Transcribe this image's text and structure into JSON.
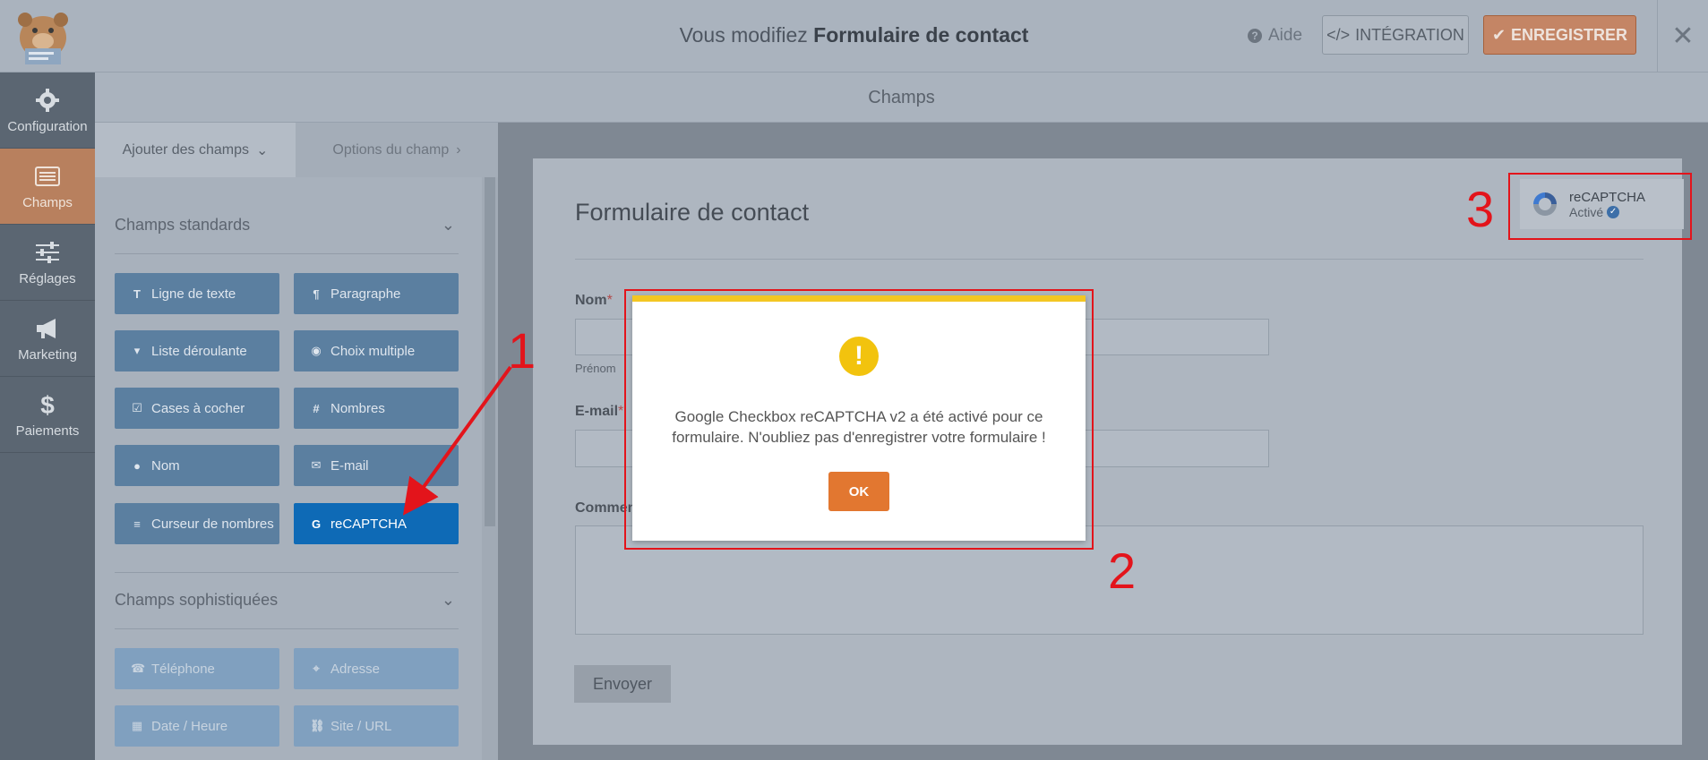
{
  "topbar": {
    "title_prefix": "Vous modifiez",
    "title_form": "Formulaire de contact",
    "help_label": "Aide",
    "embed_label": "INTÉGRATION",
    "save_label": "ENREGISTRER",
    "close_symbol": "✕"
  },
  "nav": {
    "items": [
      {
        "label": "Configuration",
        "icon": "gear-icon"
      },
      {
        "label": "Champs",
        "icon": "fields-icon",
        "active": true
      },
      {
        "label": "Réglages",
        "icon": "sliders-icon"
      },
      {
        "label": "Marketing",
        "icon": "megaphone-icon"
      },
      {
        "label": "Paiements",
        "icon": "dollar-icon"
      }
    ]
  },
  "header": {
    "title": "Champs"
  },
  "panel": {
    "tabs": {
      "add_fields": "Ajouter des champs",
      "field_options": "Options du champ"
    },
    "standard": {
      "title": "Champs standards",
      "buttons": [
        {
          "label": "Ligne de texte",
          "icon": "T"
        },
        {
          "label": "Paragraphe",
          "icon": "¶"
        },
        {
          "label": "Liste déroulante",
          "icon": "▾"
        },
        {
          "label": "Choix multiple",
          "icon": "◉"
        },
        {
          "label": "Cases à cocher",
          "icon": "☑"
        },
        {
          "label": "Nombres",
          "icon": "#"
        },
        {
          "label": "Nom",
          "icon": "👤"
        },
        {
          "label": "E-mail",
          "icon": "✉"
        },
        {
          "label": "Curseur de nombres",
          "icon": "≡"
        },
        {
          "label": "reCAPTCHA",
          "icon": "G"
        }
      ]
    },
    "fancy": {
      "title": "Champs sophistiquées",
      "buttons": [
        {
          "label": "Téléphone",
          "icon": "☎"
        },
        {
          "label": "Adresse",
          "icon": "⌖"
        },
        {
          "label": "Date / Heure",
          "icon": "▦"
        },
        {
          "label": "Site / URL",
          "icon": "⛓"
        }
      ]
    }
  },
  "form": {
    "title": "Formulaire de contact",
    "name_label": "Nom",
    "required_mark": "*",
    "first_name_sublabel": "Prénom",
    "email_label": "E-mail",
    "comment_label": "Commen",
    "submit_label": "Envoyer"
  },
  "recaptcha_badge": {
    "title": "reCAPTCHA",
    "status": "Activé"
  },
  "modal": {
    "message": "Google Checkbox reCAPTCHA v2 a été activé pour ce formulaire. N'oubliez pas d'enregistrer votre formulaire !",
    "ok_label": "OK"
  },
  "annotations": {
    "n1": "1",
    "n2": "2",
    "n3": "3",
    "color": "#e3141b"
  }
}
